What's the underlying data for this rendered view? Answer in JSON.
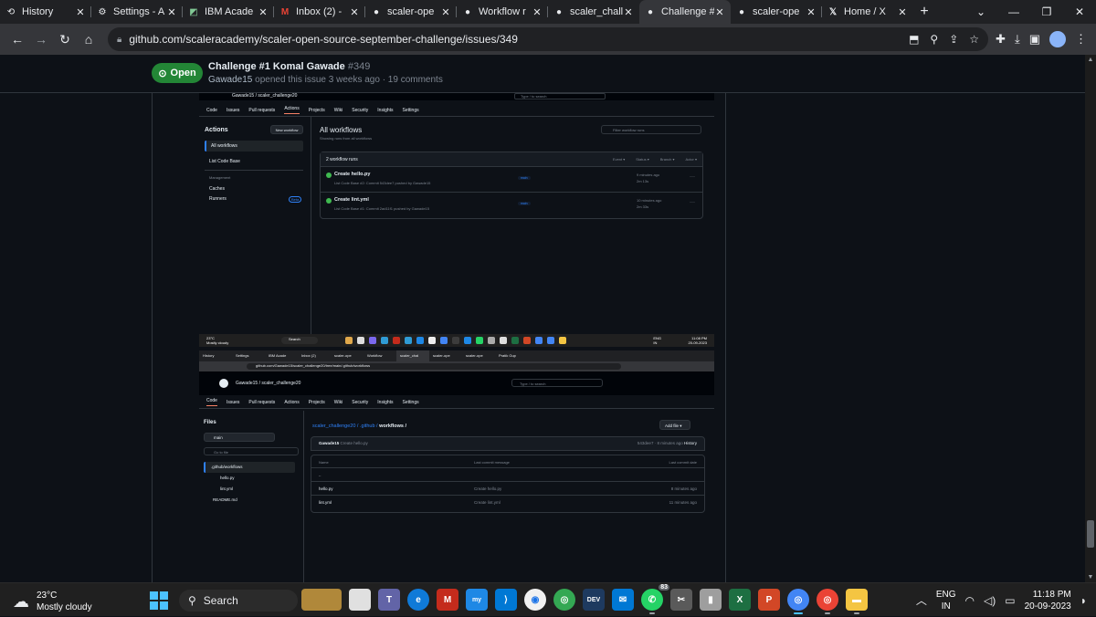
{
  "browser": {
    "tabs": [
      {
        "label": "History",
        "icon": "history-icon",
        "active": false
      },
      {
        "label": "Settings - A",
        "icon": "gear-icon",
        "active": false
      },
      {
        "label": "IBM Acade",
        "icon": "ibm-icon",
        "active": false
      },
      {
        "label": "Inbox (2) -",
        "icon": "gmail-icon",
        "active": false
      },
      {
        "label": "scaler-ope",
        "icon": "github-icon",
        "active": false
      },
      {
        "label": "Workflow r",
        "icon": "github-icon",
        "active": false
      },
      {
        "label": "scaler_chall",
        "icon": "github-icon",
        "active": false
      },
      {
        "label": "Challenge #",
        "icon": "github-icon",
        "active": true
      },
      {
        "label": "scaler-ope",
        "icon": "github-icon",
        "active": false
      },
      {
        "label": "Home / X",
        "icon": "x-icon",
        "active": false
      }
    ],
    "url": "github.com/scaleracademy/scaler-open-source-september-challenge/issues/349"
  },
  "issue": {
    "state": "Open",
    "title": "Challenge #1 Komal Gawade",
    "number": "#349",
    "author": "Gawade15",
    "meta": "opened this issue 3 weeks ago · 19 comments"
  },
  "shot1": {
    "repo": "Gawade15 / scaler_challenge20",
    "search": "Type / to search",
    "nav": [
      "Code",
      "Issues",
      "Pull requests",
      "Actions",
      "Projects",
      "Wiki",
      "Security",
      "Insights",
      "Settings"
    ],
    "sidebar": {
      "title": "Actions",
      "new_workflow": "New workflow",
      "all_workflows": "All workflows",
      "list_code_base": "List Code Base",
      "management": "Management",
      "caches": "Caches",
      "runners": "Runners",
      "beta": "Beta"
    },
    "main": {
      "title": "All workflows",
      "subtitle": "Showing runs from all workflows",
      "filter": "Filter workflow runs",
      "runs_count": "2 workflow runs",
      "filters": [
        "Event ▾",
        "Status ▾",
        "Branch ▾",
        "Actor ▾"
      ],
      "runs": [
        {
          "name": "Create hello.py",
          "sub": "List Code Base #2: Commit 543dee7 pushed by Gawade15",
          "branch": "main",
          "time": "9 minutes ago",
          "duration": "2m 13s"
        },
        {
          "name": "Create lint.yml",
          "sub": "List Code Base #1: Commit 2ad11f1 pushed by Gawade15",
          "branch": "main",
          "time": "10 minutes ago",
          "duration": "2m 33s"
        }
      ]
    },
    "taskbar": {
      "temp": "23°C",
      "weather": "Mostly cloudy",
      "search": "Search",
      "lang1": "ENG",
      "lang2": "IN",
      "time": "11:08 PM",
      "date": "20-09-2023"
    }
  },
  "shot2": {
    "tabs": [
      "History",
      "Settings",
      "IBM Acade",
      "Inbox (2)",
      "scaler-ope",
      "Workflow",
      "scaler_chal",
      "scaler-ope",
      "scaler-ope",
      "Pratik Gup"
    ],
    "url": "github.com/Gawade15/scaler_challenge20/tree/main/.github/workflows",
    "repo": "Gawade15 / scaler_challenge20",
    "search": "Type / to search",
    "nav": [
      "Code",
      "Issues",
      "Pull requests",
      "Actions",
      "Projects",
      "Wiki",
      "Security",
      "Insights",
      "Settings"
    ],
    "files_title": "Files",
    "branch": "main",
    "goto": "Go to file",
    "tree": [
      ".github/workflows",
      "hello.py",
      "lint.yml",
      "README.md"
    ],
    "crumb_repo": "scaler_challenge20",
    "crumb_mid": " / .github / ",
    "crumb_leaf": "workflows /",
    "add_file": "Add file ▾",
    "commit_author": "Gawade15",
    "commit_msg": "Create hello.py",
    "commit_right": "543dee7 · 8 minutes ago",
    "history": "History",
    "table_headers": [
      "Name",
      "Last commit message",
      "Last commit date"
    ],
    "files": [
      {
        "name": "..",
        "msg": "",
        "date": ""
      },
      {
        "name": "hello.py",
        "msg": "Create hello.py",
        "date": "8 minutes ago"
      },
      {
        "name": "lint.yml",
        "msg": "Create lint.yml",
        "date": "11 minutes ago"
      }
    ]
  },
  "taskbar": {
    "temp": "23°C",
    "weather": "Mostly cloudy",
    "search": "Search",
    "lang1": "ENG",
    "lang2": "IN",
    "time": "11:18 PM",
    "date": "20-09-2023",
    "whatsapp_badge": "83"
  }
}
